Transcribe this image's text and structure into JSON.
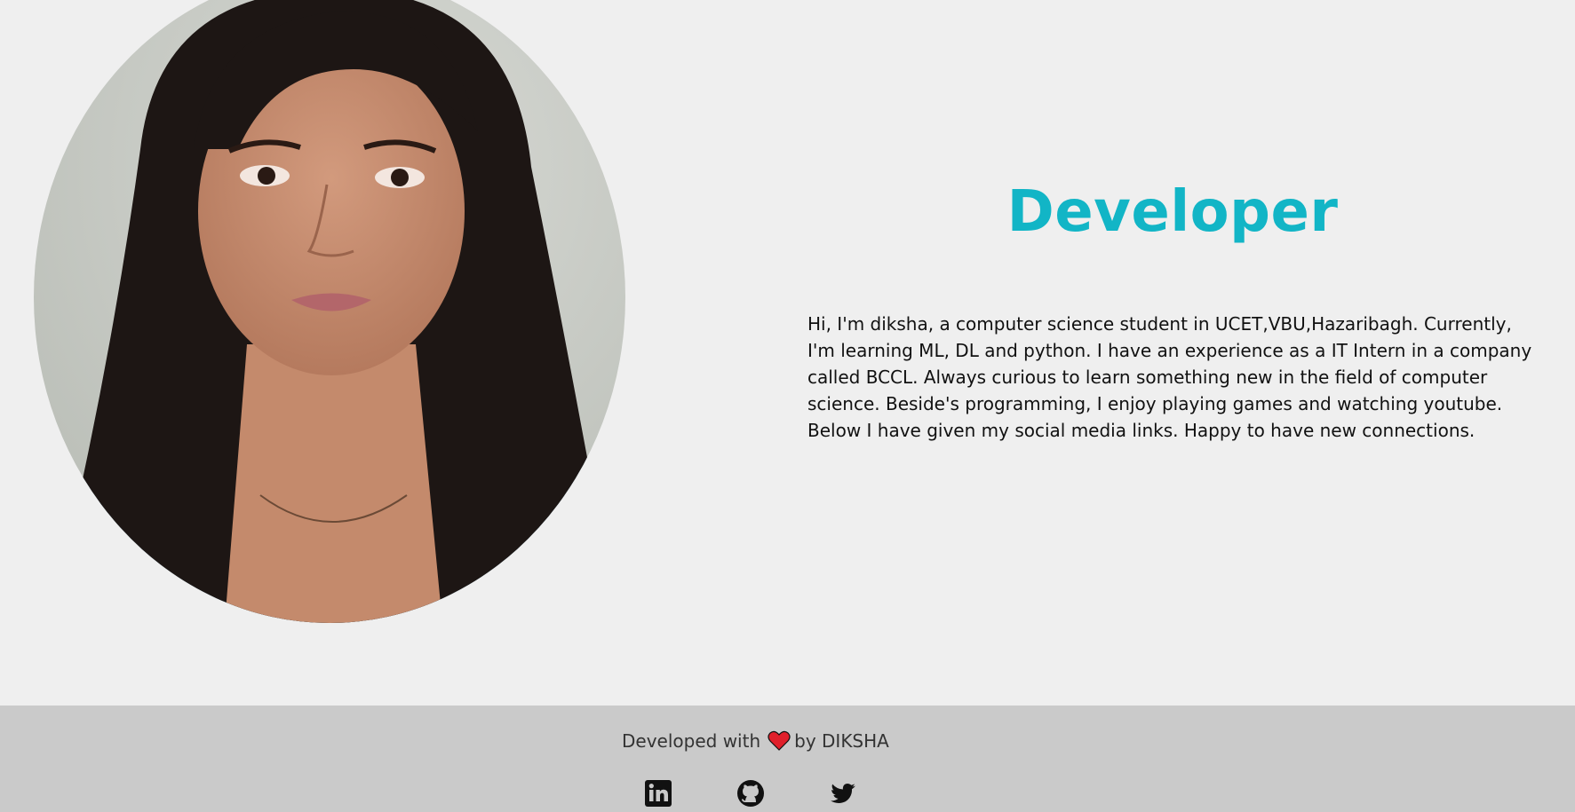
{
  "hero": {
    "title": "Developer",
    "bio": "Hi, I'm diksha, a computer science student in UCET,VBU,Hazaribagh. Currently, I'm learning ML, DL and python. I have an experience as a IT Intern in a company called BCCL. Always curious to learn something new in the field of computer science. Beside's programming, I enjoy playing games and watching youtube. Below I have given my social media links. Happy to have new connections."
  },
  "footer": {
    "credit_prefix": "Developed with",
    "credit_suffix": "by DIKSHA",
    "heart_icon": "heart-icon",
    "socials": [
      {
        "name": "linkedin",
        "icon": "linkedin-icon"
      },
      {
        "name": "github",
        "icon": "github-icon"
      },
      {
        "name": "twitter",
        "icon": "twitter-icon"
      }
    ]
  },
  "colors": {
    "background": "#efefef",
    "footer_background": "#cacaca",
    "title": "#12b5c6",
    "heart": "#e0202b"
  }
}
